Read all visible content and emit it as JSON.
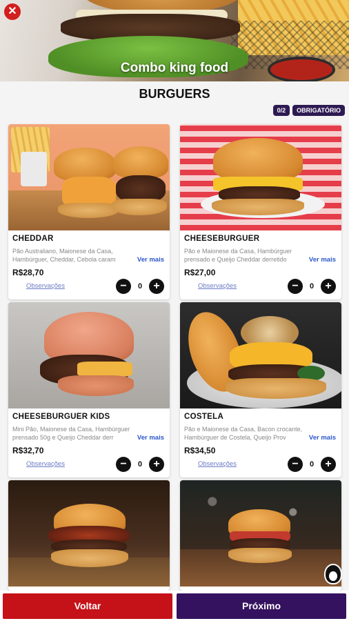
{
  "hero": {
    "title": "Combo king food",
    "close_icon": "close-icon"
  },
  "section": {
    "title": "BURGUERS",
    "count_badge": "0/2",
    "required_badge": "OBRIGATÓRIO"
  },
  "products": [
    {
      "name": "CHEDDAR",
      "description": "Pão Australiano, Maionese da Casa, Hambúrguer, Cheddar, Cebola caram",
      "more": "Ver mais",
      "price": "R$28,70",
      "obs": "Observações",
      "qty": "0"
    },
    {
      "name": "CHEESEBURGUER",
      "description": "Pão e Maionese da Casa, Hambúrguer prensado e Queijo Cheddar derretido",
      "more": "Ver mais",
      "price": "R$27,00",
      "obs": "Observações",
      "qty": "0"
    },
    {
      "name": "CHEESEBURGUER KIDS",
      "description": "Mini Pão, Maionese da Casa, Hambúrguer prensado 50g e Queijo Cheddar derr",
      "more": "Ver mais",
      "price": "R$32,70",
      "obs": "Observações",
      "qty": "0"
    },
    {
      "name": "COSTELA",
      "description": "Pão e Maionese da Casa, Bacon crocante, Hambúrguer de Costela, Queijo Prov",
      "more": "Ver mais",
      "price": "R$34,50",
      "obs": "Observações",
      "qty": "0"
    }
  ],
  "footer": {
    "back": "Voltar",
    "next": "Próximo"
  },
  "stepper": {
    "minus": "−",
    "plus": "+"
  },
  "colors": {
    "primary_red": "#c51218",
    "primary_purple": "#35125f",
    "link_blue": "#2b58c9"
  }
}
